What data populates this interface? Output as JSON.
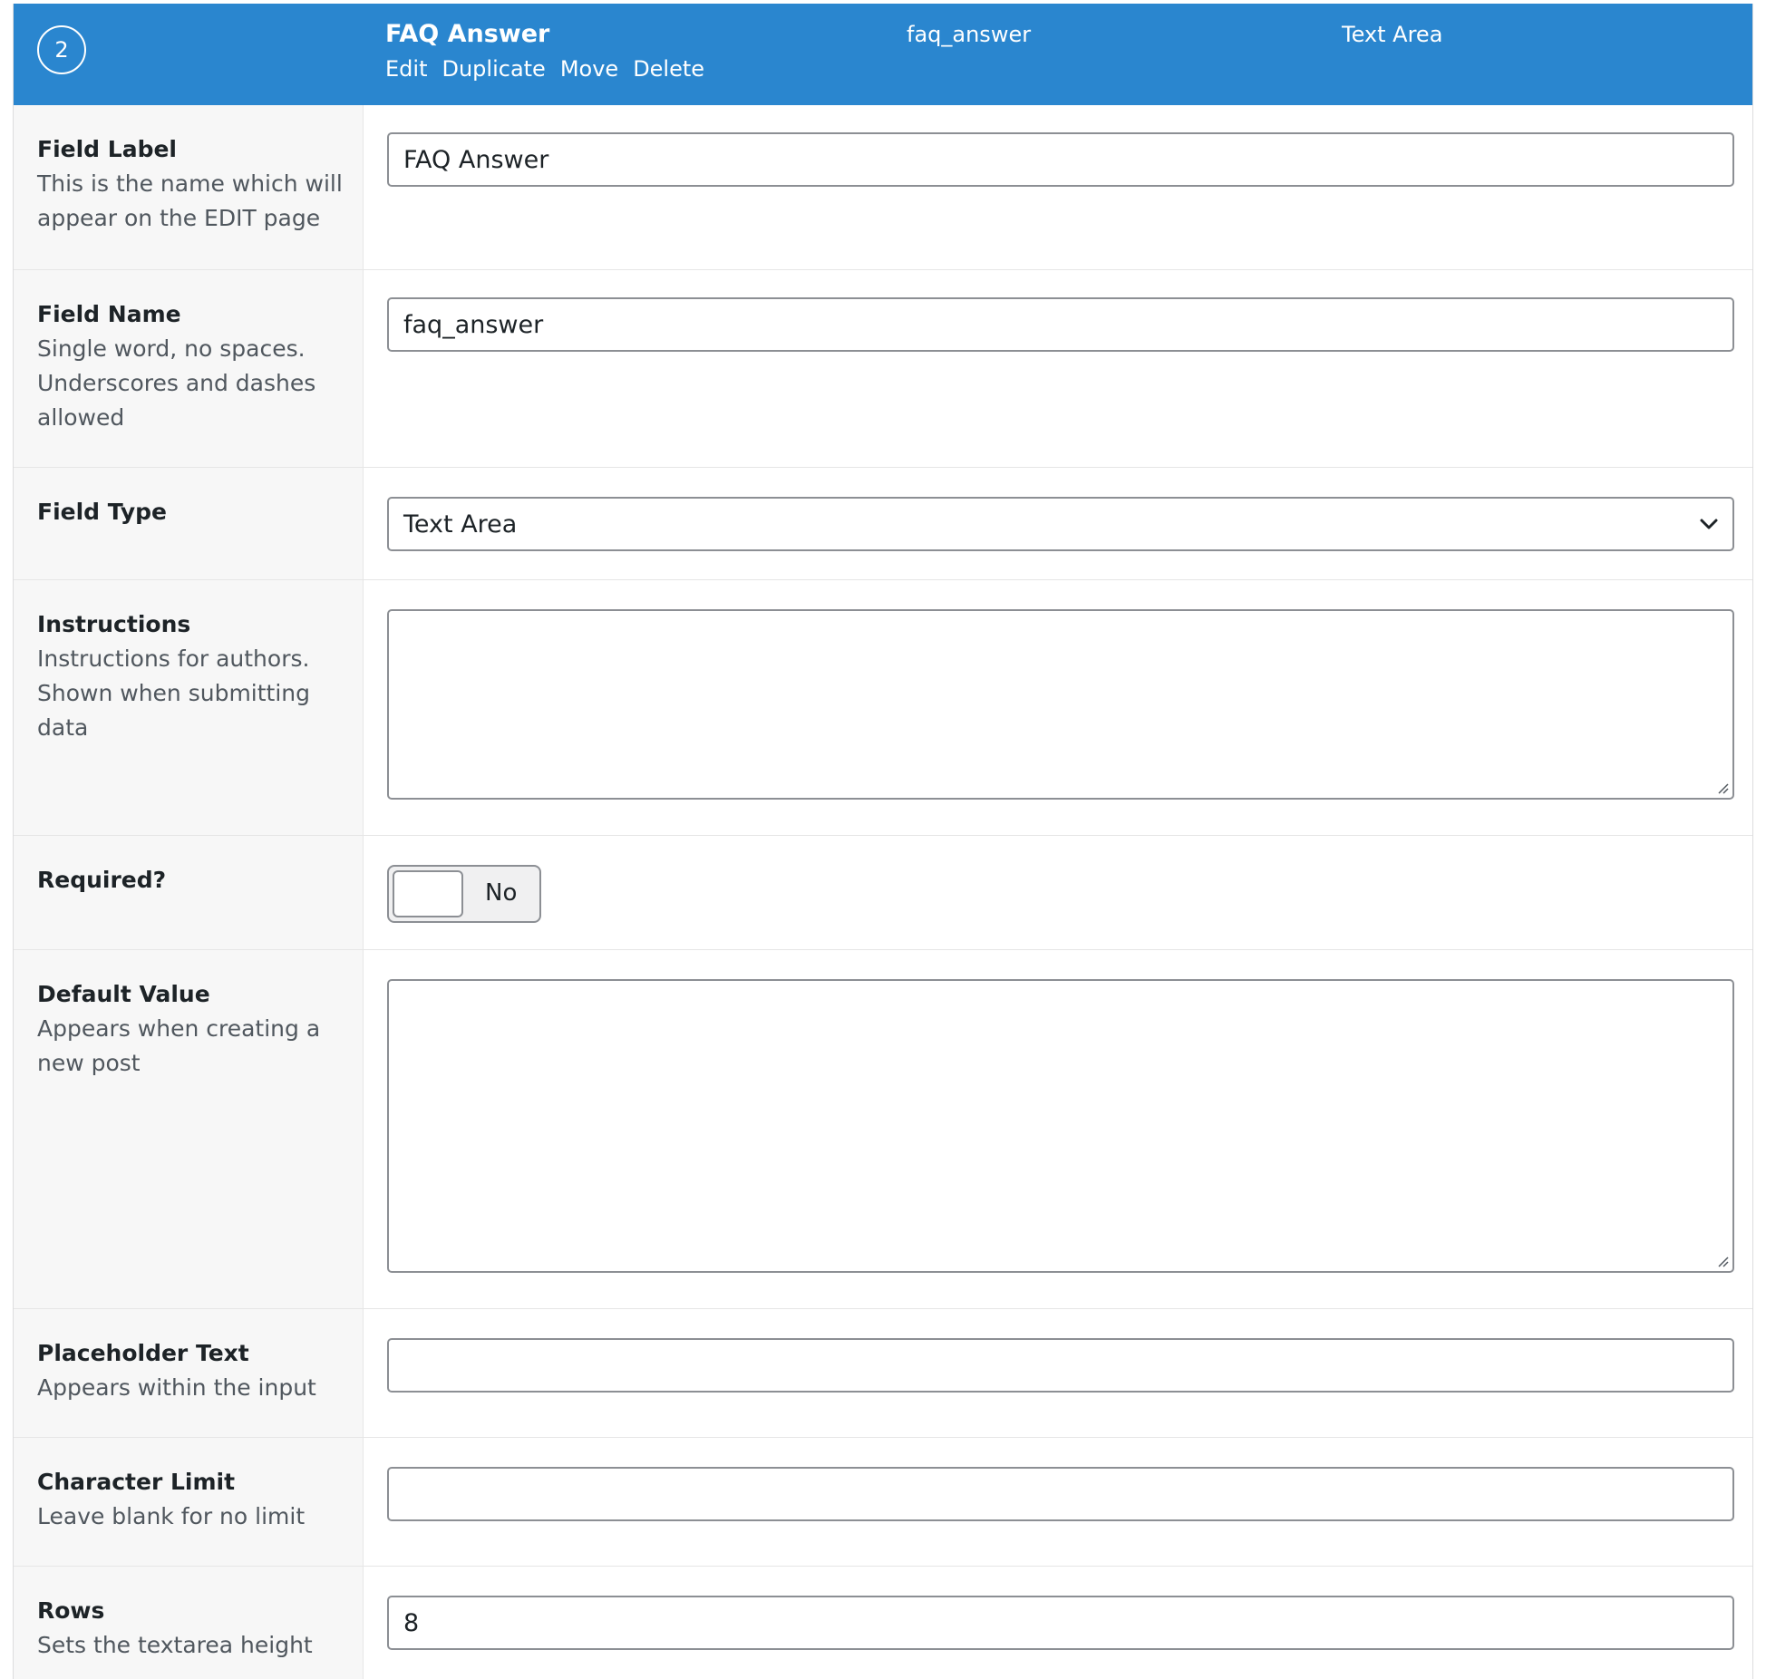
{
  "header": {
    "order": "2",
    "title": "FAQ Answer",
    "field_name": "faq_answer",
    "field_type": "Text Area",
    "actions": [
      "Edit",
      "Duplicate",
      "Move",
      "Delete"
    ],
    "accent_color": "#2a86cf"
  },
  "rows": {
    "field_label": {
      "title": "Field Label",
      "desc": [
        "This is the name which will",
        "appear on the EDIT page"
      ],
      "value": "FAQ Answer"
    },
    "field_name": {
      "title": "Field Name",
      "desc": [
        "Single word, no spaces.",
        "Underscores and dashes",
        "allowed"
      ],
      "value": "faq_answer"
    },
    "field_type": {
      "title": "Field Type",
      "selected": "Text Area"
    },
    "instructions": {
      "title": "Instructions",
      "desc": [
        "Instructions for authors.",
        "Shown when submitting",
        "data"
      ],
      "value": ""
    },
    "required": {
      "title": "Required?",
      "toggle_label": "No",
      "checked": false
    },
    "default_value": {
      "title": "Default Value",
      "desc": [
        "Appears when creating a",
        "new post"
      ],
      "value": ""
    },
    "placeholder_text": {
      "title": "Placeholder Text",
      "desc": [
        "Appears within the input"
      ],
      "value": ""
    },
    "character_limit": {
      "title": "Character Limit",
      "desc": [
        "Leave blank for no limit"
      ],
      "value": ""
    },
    "rows_setting": {
      "title": "Rows",
      "desc": [
        "Sets the textarea height"
      ],
      "value": "8"
    }
  }
}
